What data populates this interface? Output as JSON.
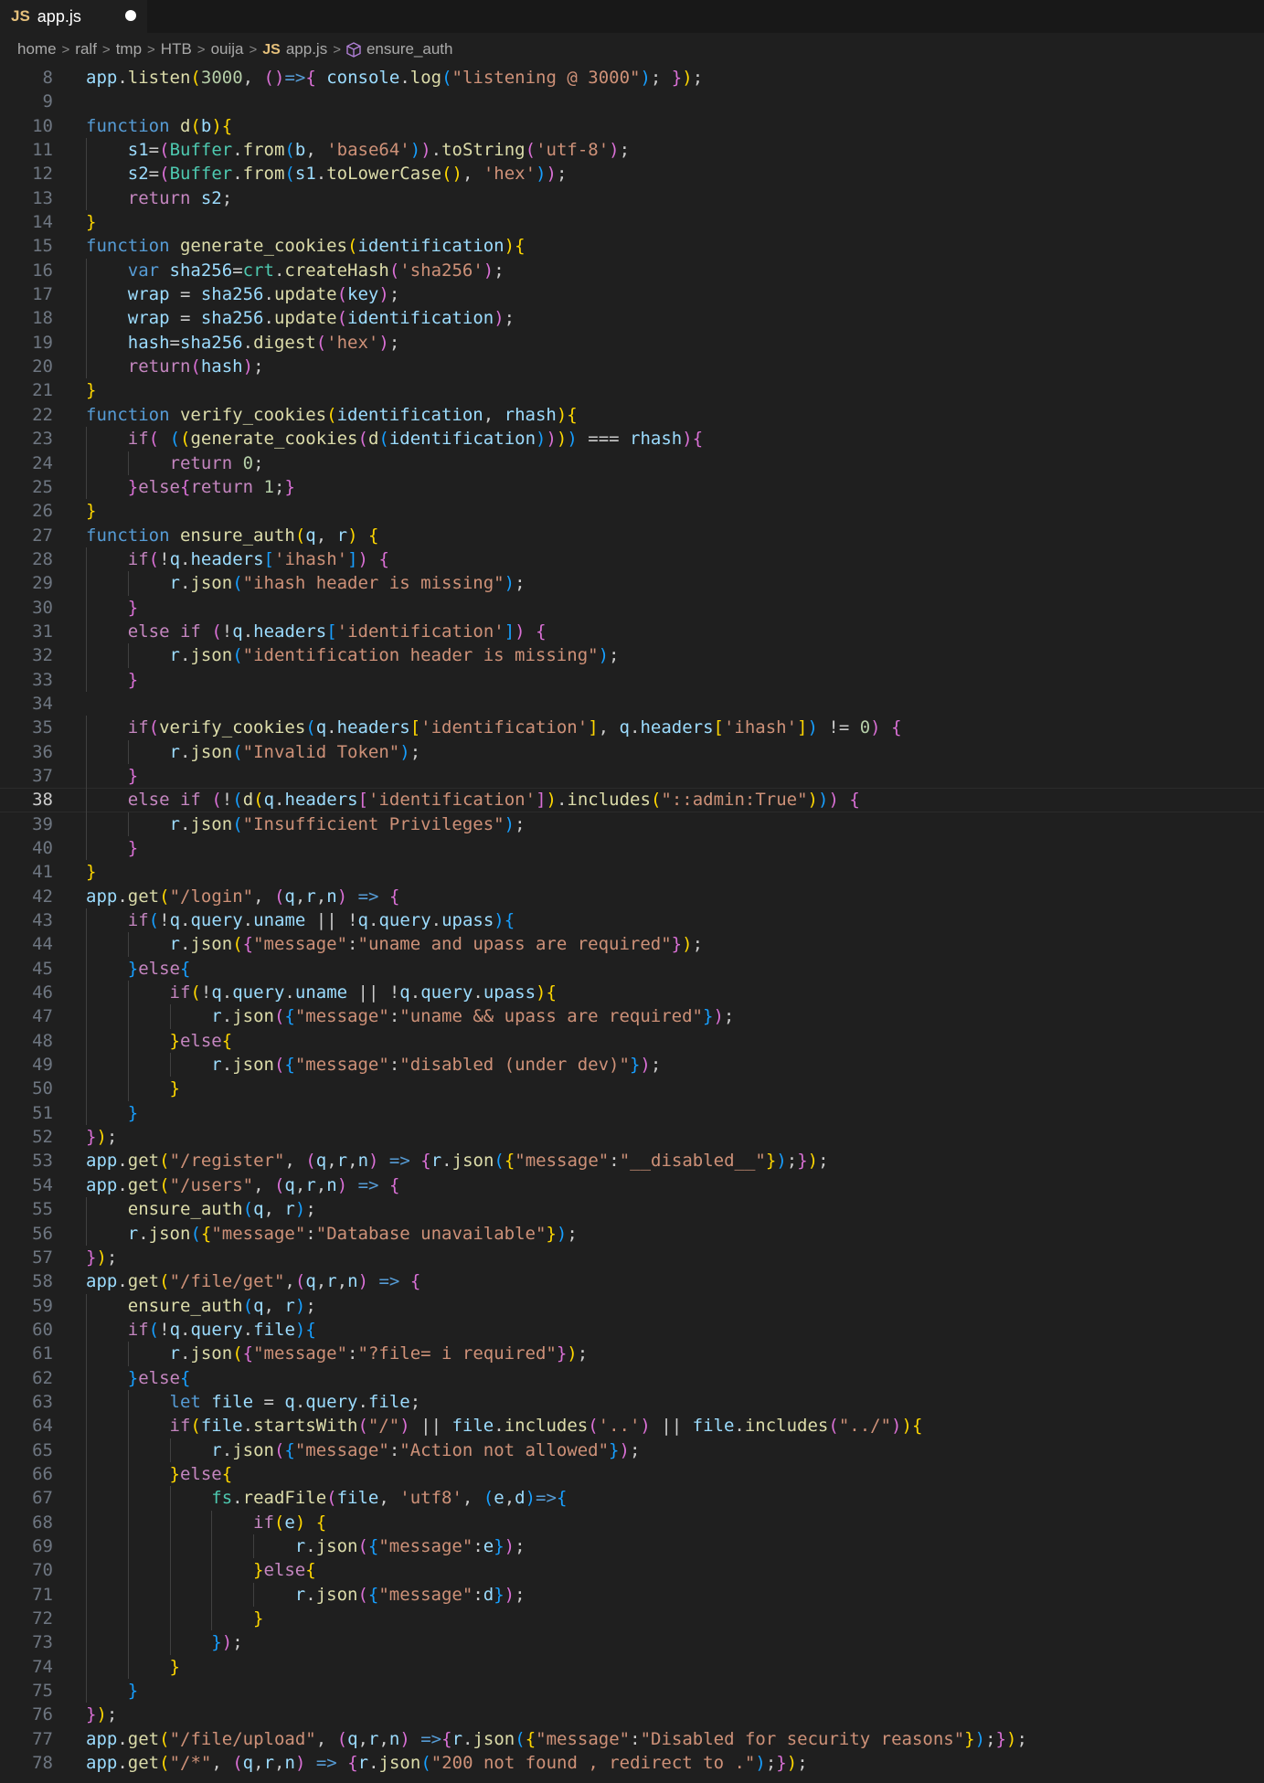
{
  "tab": {
    "icon": "JS",
    "title": "app.js",
    "modified_indicator": "unsaved-dot"
  },
  "breadcrumb": {
    "items": [
      "home",
      "ralf",
      "tmp",
      "HTB",
      "ouija"
    ],
    "file_icon": "JS",
    "file": "app.js",
    "symbol": "ensure_auth"
  },
  "editor": {
    "active_line": 38,
    "lines": [
      {
        "n": "8",
        "code": "app.listen(3000, ()=>{ console.log(\"listening @ 3000\"); });"
      },
      {
        "n": "9",
        "code": ""
      },
      {
        "n": "10",
        "code": "function d(b){"
      },
      {
        "n": "11",
        "code": "    s1=(Buffer.from(b, 'base64')).toString('utf-8');"
      },
      {
        "n": "12",
        "code": "    s2=(Buffer.from(s1.toLowerCase(), 'hex'));"
      },
      {
        "n": "13",
        "code": "    return s2;"
      },
      {
        "n": "14",
        "code": "}"
      },
      {
        "n": "15",
        "code": "function generate_cookies(identification){"
      },
      {
        "n": "16",
        "code": "    var sha256=crt.createHash('sha256');"
      },
      {
        "n": "17",
        "code": "    wrap = sha256.update(key);"
      },
      {
        "n": "18",
        "code": "    wrap = sha256.update(identification);"
      },
      {
        "n": "19",
        "code": "    hash=sha256.digest('hex');"
      },
      {
        "n": "20",
        "code": "    return(hash);"
      },
      {
        "n": "21",
        "code": "}"
      },
      {
        "n": "22",
        "code": "function verify_cookies(identification, rhash){"
      },
      {
        "n": "23",
        "code": "    if( ((generate_cookies(d(identification)))) === rhash){"
      },
      {
        "n": "24",
        "code": "        return 0;"
      },
      {
        "n": "25",
        "code": "    }else{return 1;}"
      },
      {
        "n": "26",
        "code": "}"
      },
      {
        "n": "27",
        "code": "function ensure_auth(q, r) {"
      },
      {
        "n": "28",
        "code": "    if(!q.headers['ihash']) {"
      },
      {
        "n": "29",
        "code": "        r.json(\"ihash header is missing\");"
      },
      {
        "n": "30",
        "code": "    }"
      },
      {
        "n": "31",
        "code": "    else if (!q.headers['identification']) {"
      },
      {
        "n": "32",
        "code": "        r.json(\"identification header is missing\");"
      },
      {
        "n": "33",
        "code": "    }"
      },
      {
        "n": "34",
        "code": ""
      },
      {
        "n": "35",
        "code": "    if(verify_cookies(q.headers['identification'], q.headers['ihash']) != 0) {"
      },
      {
        "n": "36",
        "code": "        r.json(\"Invalid Token\");"
      },
      {
        "n": "37",
        "code": "    }"
      },
      {
        "n": "38",
        "code": "    else if (!(d(q.headers['identification']).includes(\"::admin:True\"))) {"
      },
      {
        "n": "39",
        "code": "        r.json(\"Insufficient Privileges\");"
      },
      {
        "n": "40",
        "code": "    }"
      },
      {
        "n": "41",
        "code": "}"
      },
      {
        "n": "42",
        "code": "app.get(\"/login\", (q,r,n) => {"
      },
      {
        "n": "43",
        "code": "    if(!q.query.uname || !q.query.upass){"
      },
      {
        "n": "44",
        "code": "        r.json({\"message\":\"uname and upass are required\"});"
      },
      {
        "n": "45",
        "code": "    }else{"
      },
      {
        "n": "46",
        "code": "        if(!q.query.uname || !q.query.upass){"
      },
      {
        "n": "47",
        "code": "            r.json({\"message\":\"uname && upass are required\"});"
      },
      {
        "n": "48",
        "code": "        }else{"
      },
      {
        "n": "49",
        "code": "            r.json({\"message\":\"disabled (under dev)\"});"
      },
      {
        "n": "50",
        "code": "        }"
      },
      {
        "n": "51",
        "code": "    }"
      },
      {
        "n": "52",
        "code": "});"
      },
      {
        "n": "53",
        "code": "app.get(\"/register\", (q,r,n) => {r.json({\"message\":\"__disabled__\"});});"
      },
      {
        "n": "54",
        "code": "app.get(\"/users\", (q,r,n) => {"
      },
      {
        "n": "55",
        "code": "    ensure_auth(q, r);"
      },
      {
        "n": "56",
        "code": "    r.json({\"message\":\"Database unavailable\"});"
      },
      {
        "n": "57",
        "code": "});"
      },
      {
        "n": "58",
        "code": "app.get(\"/file/get\",(q,r,n) => {"
      },
      {
        "n": "59",
        "code": "    ensure_auth(q, r);"
      },
      {
        "n": "60",
        "code": "    if(!q.query.file){"
      },
      {
        "n": "61",
        "code": "        r.json({\"message\":\"?file= i required\"});"
      },
      {
        "n": "62",
        "code": "    }else{"
      },
      {
        "n": "63",
        "code": "        let file = q.query.file;"
      },
      {
        "n": "64",
        "code": "        if(file.startsWith(\"/\") || file.includes('..') || file.includes(\"../\")){"
      },
      {
        "n": "65",
        "code": "            r.json({\"message\":\"Action not allowed\"});"
      },
      {
        "n": "66",
        "code": "        }else{"
      },
      {
        "n": "67",
        "code": "            fs.readFile(file, 'utf8', (e,d)=>{"
      },
      {
        "n": "68",
        "code": "                if(e) {"
      },
      {
        "n": "69",
        "code": "                    r.json({\"message\":e});"
      },
      {
        "n": "70",
        "code": "                }else{"
      },
      {
        "n": "71",
        "code": "                    r.json({\"message\":d});"
      },
      {
        "n": "72",
        "code": "                }"
      },
      {
        "n": "73",
        "code": "            });"
      },
      {
        "n": "74",
        "code": "        }"
      },
      {
        "n": "75",
        "code": "    }"
      },
      {
        "n": "76",
        "code": "});"
      },
      {
        "n": "77",
        "code": "app.get(\"/file/upload\", (q,r,n) =>{r.json({\"message\":\"Disabled for security reasons\"});});"
      },
      {
        "n": "78",
        "code": "app.get(\"/*\", (q,r,n) => {r.json(\"200 not found , redirect to .\");});"
      }
    ]
  }
}
